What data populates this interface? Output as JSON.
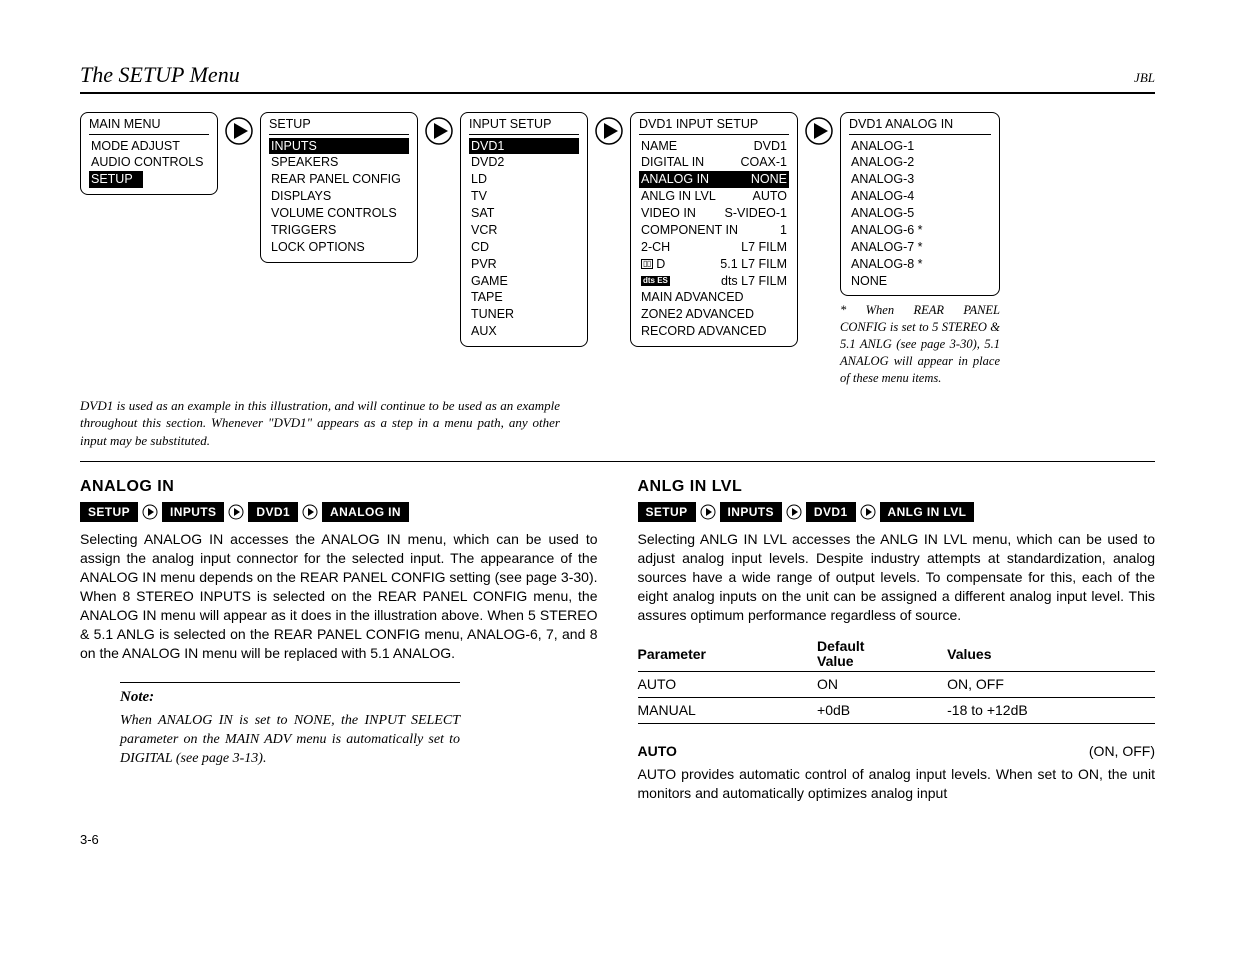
{
  "header": {
    "title": "The SETUP Menu",
    "brand": "JBL"
  },
  "nav_arrow_name": "play-right-icon",
  "menus": {
    "main": {
      "title": "MAIN MENU",
      "items": [
        {
          "label": "MODE ADJUST"
        },
        {
          "label": "AUDIO CONTROLS"
        },
        {
          "label": "SETUP",
          "selected": true
        }
      ]
    },
    "setup": {
      "title": "SETUP",
      "items": [
        {
          "label": "INPUTS",
          "selected": true
        },
        {
          "label": "SPEAKERS"
        },
        {
          "label": "REAR PANEL CONFIG"
        },
        {
          "label": "DISPLAYS"
        },
        {
          "label": "VOLUME CONTROLS"
        },
        {
          "label": "TRIGGERS"
        },
        {
          "label": "LOCK OPTIONS"
        }
      ]
    },
    "input_setup": {
      "title": "INPUT SETUP",
      "items": [
        {
          "label": "DVD1",
          "selected": true
        },
        {
          "label": "DVD2"
        },
        {
          "label": "LD"
        },
        {
          "label": "TV"
        },
        {
          "label": "SAT"
        },
        {
          "label": "VCR"
        },
        {
          "label": "CD"
        },
        {
          "label": "PVR"
        },
        {
          "label": "GAME"
        },
        {
          "label": "TAPE"
        },
        {
          "label": "TUNER"
        },
        {
          "label": "AUX"
        }
      ]
    },
    "dvd1_input_setup": {
      "title": "DVD1 INPUT SETUP",
      "rows": [
        {
          "label": "NAME",
          "value": "DVD1"
        },
        {
          "label": "DIGITAL IN",
          "value": "COAX-1"
        },
        {
          "label": "ANALOG IN",
          "value": "NONE",
          "selected": true
        },
        {
          "label": "ANLG IN LVL",
          "value": "AUTO"
        },
        {
          "label": "VIDEO IN",
          "value": "S-VIDEO-1"
        },
        {
          "label": "COMPONENT IN",
          "value": "1"
        },
        {
          "label": "2-CH",
          "value": "L7 FILM"
        },
        {
          "label": "badge:dolby",
          "value": "5.1 L7 FILM"
        },
        {
          "label": "badge:dts",
          "value": "dts L7 FILM"
        },
        {
          "label": "MAIN ADVANCED"
        },
        {
          "label": "ZONE2 ADVANCED"
        },
        {
          "label": "RECORD ADVANCED"
        }
      ]
    },
    "dvd1_analog_in": {
      "title": "DVD1 ANALOG IN",
      "items": [
        {
          "label": "ANALOG-1"
        },
        {
          "label": "ANALOG-2"
        },
        {
          "label": "ANALOG-3"
        },
        {
          "label": "ANALOG-4"
        },
        {
          "label": "ANALOG-5"
        },
        {
          "label": "ANALOG-6 *"
        },
        {
          "label": "ANALOG-7 *"
        },
        {
          "label": "ANALOG-8 *"
        },
        {
          "label": "NONE"
        }
      ]
    }
  },
  "caption_left": "DVD1 is used as an example in this illustration, and will continue to be used as an example throughout this section. Whenever \"DVD1\" appears as a step in a menu path, any other input may be substituted.",
  "caption_right_prefix": "* ",
  "caption_right": "When REAR PANEL CONFIG is set to 5 STEREO & 5.1 ANLG (see page 3-30), 5.1 ANALOG will appear in place of these menu items.",
  "left_section": {
    "heading": "ANALOG IN",
    "crumbs": [
      "SETUP",
      "INPUTS",
      "DVD1",
      "ANALOG IN"
    ],
    "body": "Selecting ANALOG IN accesses the ANALOG IN menu, which can be used to assign the analog input connector for the selected input. The appearance of the ANALOG IN menu depends on the REAR PANEL CONFIG setting (see page 3-30).  When 8 STEREO INPUTS is selected on the REAR PANEL CONFIG menu, the ANALOG IN menu will appear as it does in the illustration above. When 5 STEREO & 5.1 ANLG is selected on the REAR PANEL CONFIG menu, ANALOG-6, 7, and 8 on the ANALOG IN menu will be replaced with 5.1 ANALOG.",
    "note_title": "Note:",
    "note_body": "When ANALOG IN is set to NONE, the INPUT SELECT parameter on the MAIN ADV menu is automatically set to DIGITAL (see page 3-13)."
  },
  "right_section": {
    "heading": "ANLG IN LVL",
    "crumbs": [
      "SETUP",
      "INPUTS",
      "DVD1",
      "ANLG IN LVL"
    ],
    "body": "Selecting ANLG IN LVL accesses the ANLG IN LVL menu, which can be used to adjust analog input levels. Despite industry attempts at standardization, analog sources have a wide range of output levels.  To compensate for this, each of the eight analog inputs on the unit can be assigned a different analog input level. This assures optimum performance regardless of source.",
    "table": {
      "headers": [
        "Parameter",
        "Default Value",
        "Values"
      ],
      "rows": [
        {
          "param": "AUTO",
          "default": "ON",
          "values": "ON, OFF"
        },
        {
          "param": "MANUAL",
          "default": "+0dB",
          "values": "-18 to +12dB"
        }
      ]
    },
    "param_name": "AUTO",
    "param_vals": "(ON, OFF)",
    "param_body": "AUTO provides automatic control of analog input levels.  When set to ON, the unit monitors and automatically optimizes analog input"
  },
  "page_number": "3-6"
}
